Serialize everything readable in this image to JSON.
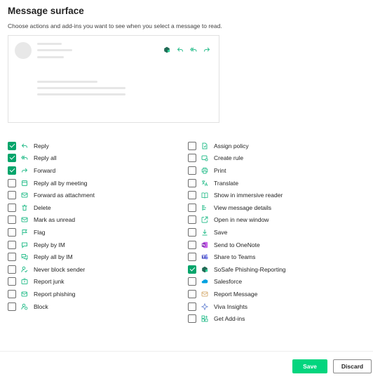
{
  "header": {
    "title": "Message surface",
    "subtitle": "Choose actions and add-ins you want to see when you select a message to read."
  },
  "preview": {
    "icons": [
      "sosafe-icon",
      "reply-icon",
      "reply-all-icon",
      "forward-icon"
    ]
  },
  "colors": {
    "accent": "#03a56b",
    "save_button": "#03d57e",
    "icon_teal": "#2fbf8f",
    "sosafe_dark": "#1f6b55",
    "onenote_purple": "#7719aa",
    "teams_purple": "#5b5fc7",
    "salesforce_blue": "#00a1e0",
    "viva_blue": "#6f8bd6"
  },
  "left_items": [
    {
      "label": "Reply",
      "checked": true,
      "icon": "reply-icon"
    },
    {
      "label": "Reply all",
      "checked": true,
      "icon": "reply-all-icon"
    },
    {
      "label": "Forward",
      "checked": true,
      "icon": "forward-icon"
    },
    {
      "label": "Reply all by meeting",
      "checked": false,
      "icon": "meeting-icon"
    },
    {
      "label": "Forward as attachment",
      "checked": false,
      "icon": "forward-attachment-icon"
    },
    {
      "label": "Delete",
      "checked": false,
      "icon": "delete-icon"
    },
    {
      "label": "Mark as unread",
      "checked": false,
      "icon": "mail-unread-icon"
    },
    {
      "label": "Flag",
      "checked": false,
      "icon": "flag-icon"
    },
    {
      "label": "Reply by IM",
      "checked": false,
      "icon": "chat-icon"
    },
    {
      "label": "Reply all by IM",
      "checked": false,
      "icon": "chat-multiple-icon"
    },
    {
      "label": "Never block sender",
      "checked": false,
      "icon": "person-check-icon"
    },
    {
      "label": "Report junk",
      "checked": false,
      "icon": "report-junk-icon"
    },
    {
      "label": "Report phishing",
      "checked": false,
      "icon": "report-phishing-icon"
    },
    {
      "label": "Block",
      "checked": false,
      "icon": "block-person-icon"
    }
  ],
  "right_items": [
    {
      "label": "Assign policy",
      "checked": false,
      "icon": "policy-icon"
    },
    {
      "label": "Create rule",
      "checked": false,
      "icon": "rule-icon"
    },
    {
      "label": "Print",
      "checked": false,
      "icon": "print-icon"
    },
    {
      "label": "Translate",
      "checked": false,
      "icon": "translate-icon"
    },
    {
      "label": "Show in immersive reader",
      "checked": false,
      "icon": "immersive-reader-icon"
    },
    {
      "label": "View message details",
      "checked": false,
      "icon": "message-details-icon"
    },
    {
      "label": "Open in new window",
      "checked": false,
      "icon": "open-window-icon"
    },
    {
      "label": "Save",
      "checked": false,
      "icon": "save-icon"
    },
    {
      "label": "Send to OneNote",
      "checked": false,
      "icon": "onenote-icon"
    },
    {
      "label": "Share to Teams",
      "checked": false,
      "icon": "teams-icon"
    },
    {
      "label": "SoSafe Phishing-Reporting",
      "checked": true,
      "icon": "sosafe-icon"
    },
    {
      "label": "Salesforce",
      "checked": false,
      "icon": "salesforce-icon"
    },
    {
      "label": "Report Message",
      "checked": false,
      "icon": "report-message-icon"
    },
    {
      "label": "Viva Insights",
      "checked": false,
      "icon": "viva-insights-icon"
    },
    {
      "label": "Get Add-ins",
      "checked": false,
      "icon": "get-addins-icon"
    }
  ],
  "footer": {
    "save_label": "Save",
    "discard_label": "Discard"
  }
}
